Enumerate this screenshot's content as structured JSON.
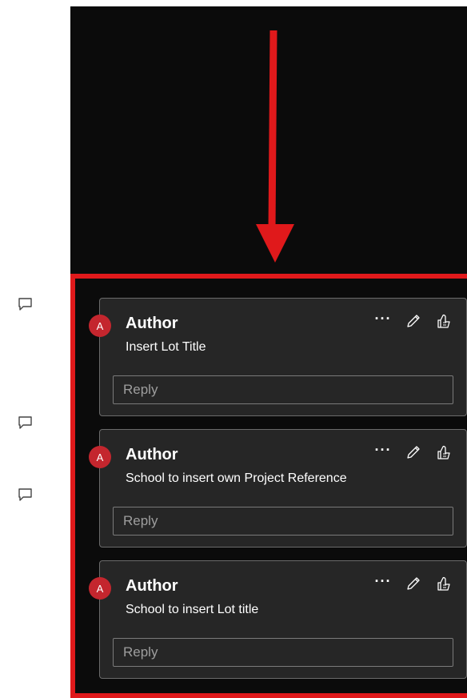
{
  "comments": [
    {
      "avatar_initial": "A",
      "author": "Author",
      "text": "Insert Lot Title",
      "reply_placeholder": "Reply"
    },
    {
      "avatar_initial": "A",
      "author": "Author",
      "text": "School to insert own Project Reference",
      "reply_placeholder": "Reply"
    },
    {
      "avatar_initial": "A",
      "author": "Author",
      "text": "School to insert Lot title",
      "reply_placeholder": "Reply"
    }
  ],
  "icons": {
    "more": "more-options-icon",
    "edit": "pencil-icon",
    "like": "thumbs-up-icon",
    "comment": "comment-bubble-icon"
  },
  "colors": {
    "annotation_red": "#e0191b",
    "avatar_red": "#c4262e",
    "card_background": "#262626",
    "pane_background": "#0b0b0b"
  }
}
